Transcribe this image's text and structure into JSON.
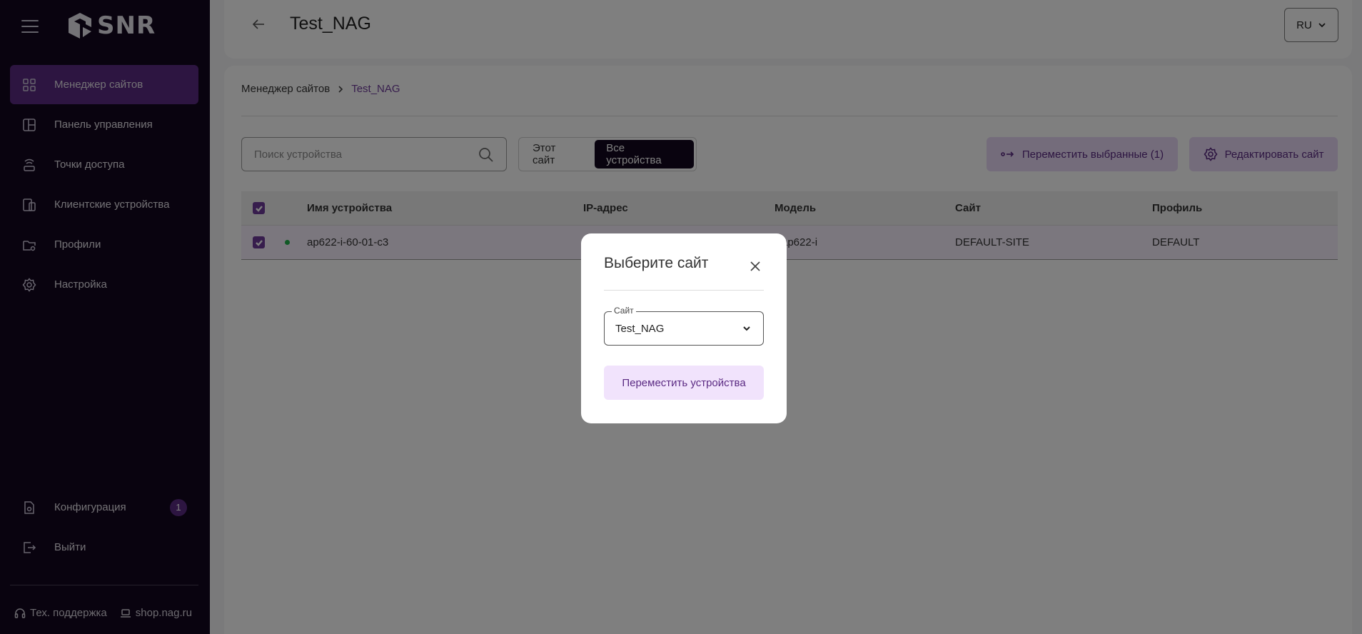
{
  "sidebar": {
    "logo": "SNR",
    "items": [
      {
        "label": "Менеджер сайтов",
        "icon": "grid-icon"
      },
      {
        "label": "Панель управления",
        "icon": "dashboard-icon"
      },
      {
        "label": "Точки доступа",
        "icon": "access-point-icon"
      },
      {
        "label": "Клиентские устройства",
        "icon": "devices-icon"
      },
      {
        "label": "Профили",
        "icon": "folder-settings-icon"
      },
      {
        "label": "Настройка",
        "icon": "gear-icon"
      }
    ],
    "bottom": [
      {
        "label": "Конфигурация",
        "icon": "config-file-icon",
        "badge": "1"
      },
      {
        "label": "Выйти",
        "icon": "logout-icon"
      }
    ],
    "footer": {
      "support": "Тех. поддержка",
      "shop": "shop.nag.ru"
    }
  },
  "header": {
    "title": "Test_NAG",
    "lang": "RU"
  },
  "breadcrumb": {
    "root": "Менеджер сайтов",
    "current": "Test_NAG"
  },
  "toolbar": {
    "search_placeholder": "Поиск устройства",
    "seg_this_site": "Этот сайт",
    "seg_all_devices": "Все устройства",
    "move_selected": "Переместить выбранные (1)",
    "edit_site": "Редактировать сайт"
  },
  "table": {
    "headers": [
      "Имя устройства",
      "IP-адрес",
      "Модель",
      "Сайт",
      "Профиль"
    ],
    "rows": [
      {
        "name": "ap622-i-60-01-c3",
        "ip": "",
        "model": "r-ap622-i",
        "site": "DEFAULT-SITE",
        "profile": "DEFAULT"
      }
    ]
  },
  "modal": {
    "title": "Выберите сайт",
    "field_label": "Сайт",
    "field_value": "Test_NAG",
    "action": "Переместить устройства"
  },
  "colors": {
    "sidebar_bg": "#13071f",
    "accent": "#5a2a82",
    "accent_light": "#e9d9f7",
    "online": "#20b34a"
  }
}
